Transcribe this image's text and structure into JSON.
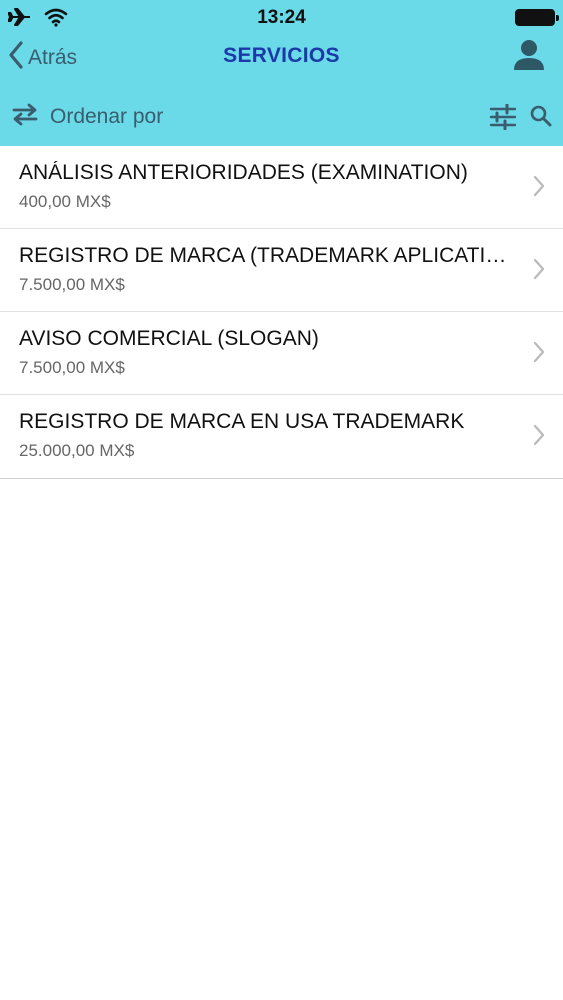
{
  "status": {
    "time": "13:24"
  },
  "nav": {
    "back_label": "Atrás",
    "title": "SERVICIOS"
  },
  "toolbar": {
    "sort_label": "Ordenar por"
  },
  "services": [
    {
      "name": "ANÁLISIS ANTERIORIDADES (EXAMINATION)",
      "price": "400,00 MX$"
    },
    {
      "name": "REGISTRO DE MARCA (TRADEMARK APLICATION)",
      "price": "7.500,00 MX$"
    },
    {
      "name": "AVISO COMERCIAL (SLOGAN)",
      "price": "7.500,00 MX$"
    },
    {
      "name": "REGISTRO DE MARCA EN USA TRADEMARK",
      "price": "25.000,00 MX$"
    }
  ],
  "colors": {
    "header_bg": "#6ad9e8",
    "title": "#1b3aa8",
    "icon": "#3a5d6e"
  },
  "icons": [
    "airplane-icon",
    "wifi-icon",
    "battery-icon",
    "chevron-left-icon",
    "user-icon",
    "swap-arrows-icon",
    "sliders-icon",
    "search-icon",
    "chevron-right-icon"
  ]
}
